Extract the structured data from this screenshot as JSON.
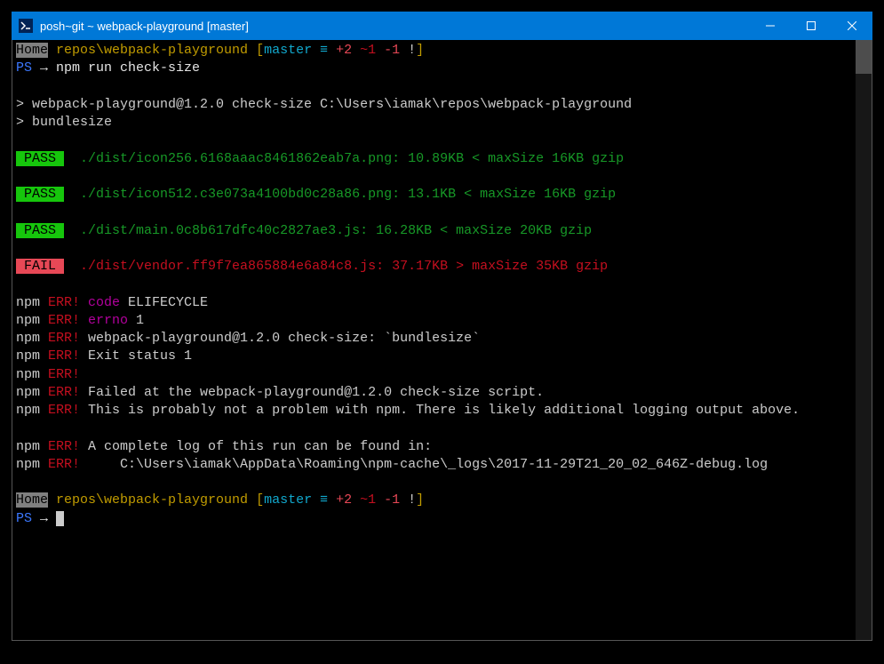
{
  "window": {
    "title": "posh~git ~ webpack-playground [master]"
  },
  "prompt": {
    "home": "Home",
    "path": " repos\\webpack-playground ",
    "branch_open": "[",
    "branch": "master",
    "equiv": " ≡ ",
    "ahead": "+2",
    "behind": " ~1",
    "removed": " -1",
    "bang": " !",
    "branch_close": "]"
  },
  "ps": {
    "label": "PS",
    "arrow": " → ",
    "cmd": "npm run check-size"
  },
  "run": {
    "line1": "> webpack-playground@1.2.0 check-size C:\\Users\\iamak\\repos\\webpack-playground",
    "line2": "> bundlesize"
  },
  "results": [
    {
      "status": "PASS",
      "text": "./dist/icon256.6168aaac8461862eab7a.png: 10.89KB < maxSize 16KB gzip"
    },
    {
      "status": "PASS",
      "text": "./dist/icon512.c3e073a4100bd0c28a86.png: 13.1KB < maxSize 16KB gzip"
    },
    {
      "status": "PASS",
      "text": "./dist/main.0c8b617dfc40c2827ae3.js: 16.28KB < maxSize 20KB gzip"
    },
    {
      "status": "FAIL",
      "text": "./dist/vendor.ff9f7ea865884e6a84c8.js: 37.17KB > maxSize 35KB gzip"
    }
  ],
  "err": {
    "npm": "npm",
    "err": " ERR!",
    "code_lbl": " code",
    "code_val": " ELIFECYCLE",
    "errno_lbl": " errno",
    "errno_val": " 1",
    "pkg": " webpack-playground@1.2.0 check-size: `bundlesize`",
    "exit": " Exit status 1",
    "failed": " Failed at the webpack-playground@1.2.0 check-size script.",
    "probably": " This is probably not a problem with npm. There is likely additional logging output above.",
    "loghead": " A complete log of this run can be found in:",
    "logpath": "     C:\\Users\\iamak\\AppData\\Roaming\\npm-cache\\_logs\\2017-11-29T21_20_02_646Z-debug.log"
  }
}
